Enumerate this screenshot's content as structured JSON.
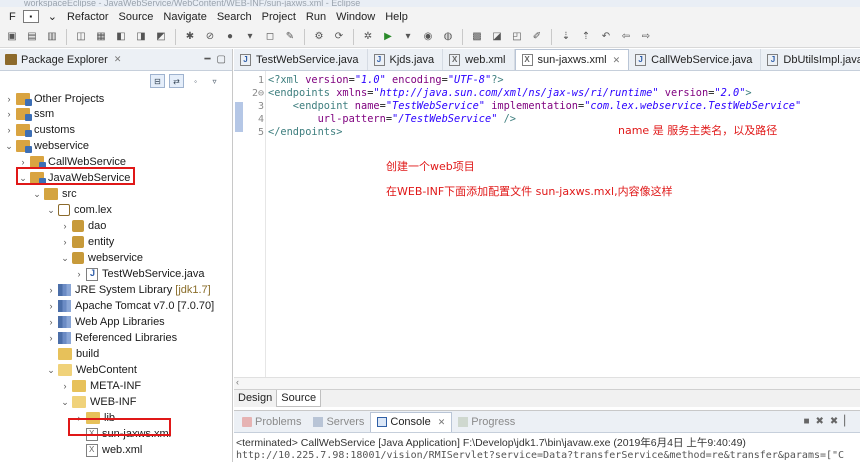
{
  "window": {
    "title": "workspaceEclipse - JavaWebService/WebContent/WEB-INF/sun-jaxws.xml - Eclipse"
  },
  "menubar": {
    "items": [
      "F",
      "Refactor",
      "Source",
      "Navigate",
      "Search",
      "Project",
      "Run",
      "Window",
      "Help"
    ]
  },
  "explorer": {
    "title": "Package Explorer",
    "tree": [
      {
        "label": "Other Projects"
      },
      {
        "label": "ssm"
      },
      {
        "label": "customs"
      },
      {
        "label": "webservice"
      },
      {
        "label": "CallWebService"
      },
      {
        "label": "JavaWebService"
      },
      {
        "label": "src"
      },
      {
        "label": "com.lex"
      },
      {
        "label": "dao"
      },
      {
        "label": "entity"
      },
      {
        "label": "webservice"
      },
      {
        "label": "TestWebService.java"
      },
      {
        "label": "JRE System Library",
        "suffix": "[jdk1.7]"
      },
      {
        "label": "Apache Tomcat v7.0 [7.0.70]"
      },
      {
        "label": "Web App Libraries"
      },
      {
        "label": "Referenced Libraries"
      },
      {
        "label": "build"
      },
      {
        "label": "WebContent"
      },
      {
        "label": "META-INF"
      },
      {
        "label": "WEB-INF"
      },
      {
        "label": "lib"
      },
      {
        "label": "sun-jaxws.xml"
      },
      {
        "label": "web.xml"
      }
    ]
  },
  "editor": {
    "tabs": [
      {
        "label": "TestWebService.java",
        "icon": "J"
      },
      {
        "label": "Kjds.java",
        "icon": "J"
      },
      {
        "label": "web.xml",
        "icon": "X"
      },
      {
        "label": "sun-jaxws.xml",
        "icon": "X",
        "active": true
      },
      {
        "label": "CallWebService.java",
        "icon": "J"
      },
      {
        "label": "DbUtilsImpl.java",
        "icon": "J"
      }
    ],
    "line_numbers": [
      "1",
      "2⊖",
      "3",
      "4",
      "5"
    ],
    "code": {
      "l1": {
        "a": "<?xml ",
        "b": "version",
        "c": "=",
        "d": "\"1.0\"",
        "e": " encoding",
        "f": "=",
        "g": "\"UTF-8\"",
        "h": "?>"
      },
      "l2": {
        "a": "<endpoints ",
        "b": "xmlns",
        "c": "=",
        "d": "\"http://java.sun.com/xml/ns/jax-ws/ri/runtime\"",
        "e": " version",
        "f": "=",
        "g": "\"2.0\"",
        "h": ">"
      },
      "l3": {
        "a": "    <endpoint ",
        "b": "name",
        "c": "=",
        "d": "\"TestWebService\"",
        "e": " implementation",
        "f": "=",
        "g": "\"com.lex.webservice.TestWebService\""
      },
      "l4": {
        "a": "        ",
        "b": "url-pattern",
        "c": "=",
        "d": "\"/TestWebService\"",
        "e": " />"
      },
      "l5": {
        "a": "</endpoints>"
      }
    },
    "annotations": {
      "name_note": "name 是 服务主类名，以及路径",
      "create_note": "创建一个web项目",
      "config_note": "在WEB-INF下面添加配置文件 sun-jaxws.mxl,内容像这样"
    },
    "bottom_tabs": [
      "Design",
      "Source"
    ]
  },
  "console": {
    "tabs": [
      {
        "label": "Problems",
        "active": false
      },
      {
        "label": "Servers",
        "active": false
      },
      {
        "label": "Console",
        "active": true
      },
      {
        "label": "Progress",
        "active": false
      }
    ],
    "terminated_line": "<terminated> CallWebService [Java Application] F:\\Develop\\jdk1.7\\bin\\javaw.exe (2019年6月4日 上午9:40:49)",
    "output_line": "http://10.225.7.98:18001/vision/RMIServlet?service=Data?transferService&method=re&transfer&params=[\"C"
  },
  "colors": {
    "highlight_box": "#e01818",
    "annotation_text": "#e01818",
    "tag": "#3f7f7f",
    "attribute": "#7f007f",
    "string": "#2a00ff"
  }
}
